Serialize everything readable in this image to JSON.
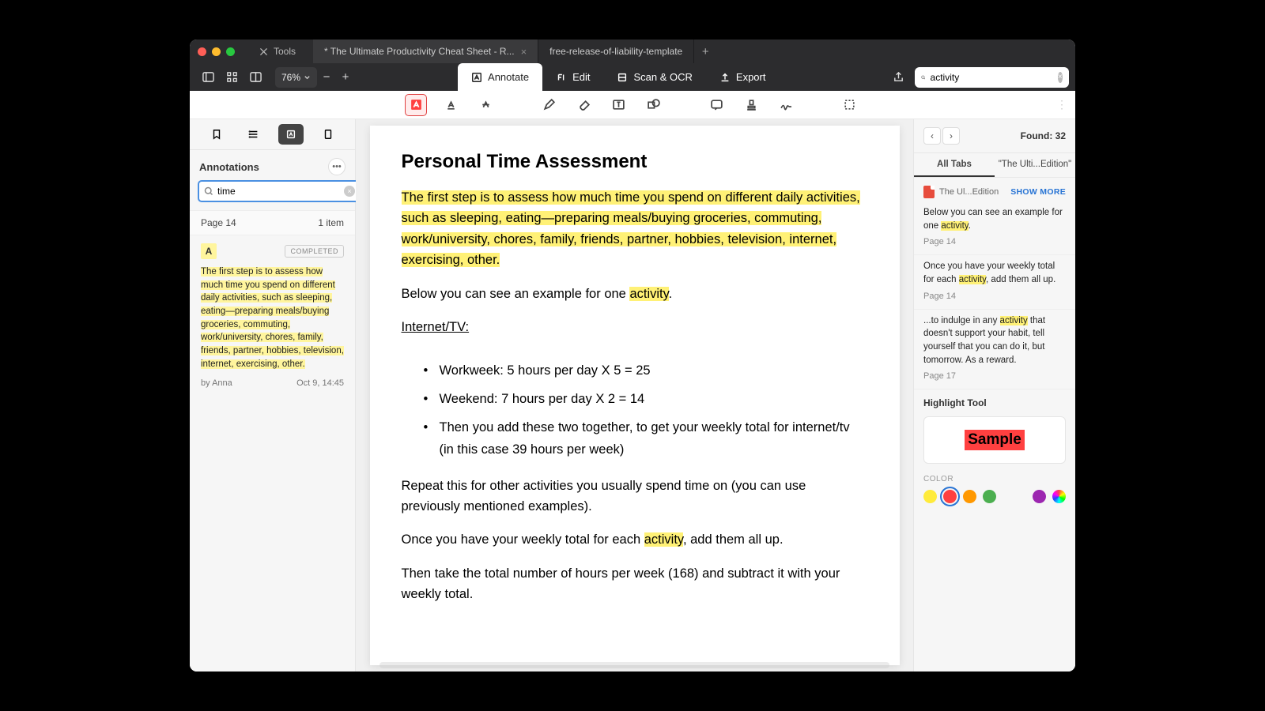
{
  "titlebar": {
    "tools_label": "Tools",
    "tabs": [
      {
        "label": "* The Ultimate Productivity Cheat Sheet - R...",
        "active": true,
        "closable": true
      },
      {
        "label": "free-release-of-liability-template",
        "active": false,
        "closable": false
      }
    ]
  },
  "toolbar": {
    "zoom": "76%",
    "modes": {
      "annotate": "Annotate",
      "edit": "Edit",
      "scan": "Scan & OCR",
      "export": "Export"
    },
    "search_value": "activity"
  },
  "left": {
    "header": "Annotations",
    "search_value": "time",
    "page_label": "Page 14",
    "item_count": "1 item",
    "completed": "COMPLETED",
    "annotation_text": "The first step is to assess how much time you spend on different daily activities, such as sleeping, eating—preparing meals/buying groceries, commuting, work/university, chores, family, friends, partner, hobbies, television, internet, exercising, other.",
    "author": "by Anna",
    "date": "Oct 9, 14:45"
  },
  "doc": {
    "title": "Personal Time Assessment",
    "para1": "The first step is to assess how much time you spend on different daily activities, such as sleeping, eating—preparing meals/buying groceries, commuting, work/university, chores, family, friends, partner, hobbies, television, internet, exercising, other.",
    "para2_a": "Below you can see an example for one ",
    "para2_hl": "activity",
    "para2_b": ".",
    "subtitle": "Internet/TV:",
    "li1": "Workweek: 5 hours per day X 5 = 25",
    "li2": "Weekend: 7 hours per day X 2 = 14",
    "li3": "Then you add these two together, to get your weekly total for internet/tv (in this case 39 hours per week)",
    "para3": "Repeat this for other activities you usually spend time on (you can use previously mentioned examples).",
    "para4_a": "Once you have your weekly total for each ",
    "para4_hl": "activity",
    "para4_b": ", add them all up.",
    "para5": "Then take the total number of hours per week (168) and subtract it with your weekly total."
  },
  "right": {
    "found": "Found: 32",
    "tab_all": "All Tabs",
    "tab_doc": "\"The Ulti...Edition\"",
    "source": "The Ul...Edition",
    "show_more": "SHOW MORE",
    "results": [
      {
        "pre": "Below you can see an example for one ",
        "hl": "activity",
        "post": ".",
        "page": "Page 14"
      },
      {
        "pre": "Once you have your weekly total for each ",
        "hl": "activity",
        "post": ", add them all up.",
        "page": "Page 14"
      },
      {
        "pre": "...to indulge in any ",
        "hl": "activity",
        "post": " that doesn't support your habit, tell yourself that you can do it, but tomorrow. As a reward.",
        "page": "Page 17"
      }
    ],
    "tool_header": "Highlight Tool",
    "sample": "Sample",
    "color_label": "COLOR",
    "colors": [
      "#ffeb3b",
      "#ff4040",
      "#ff9800",
      "#4caf50",
      "#9c27b0"
    ],
    "selected_color": 1
  }
}
